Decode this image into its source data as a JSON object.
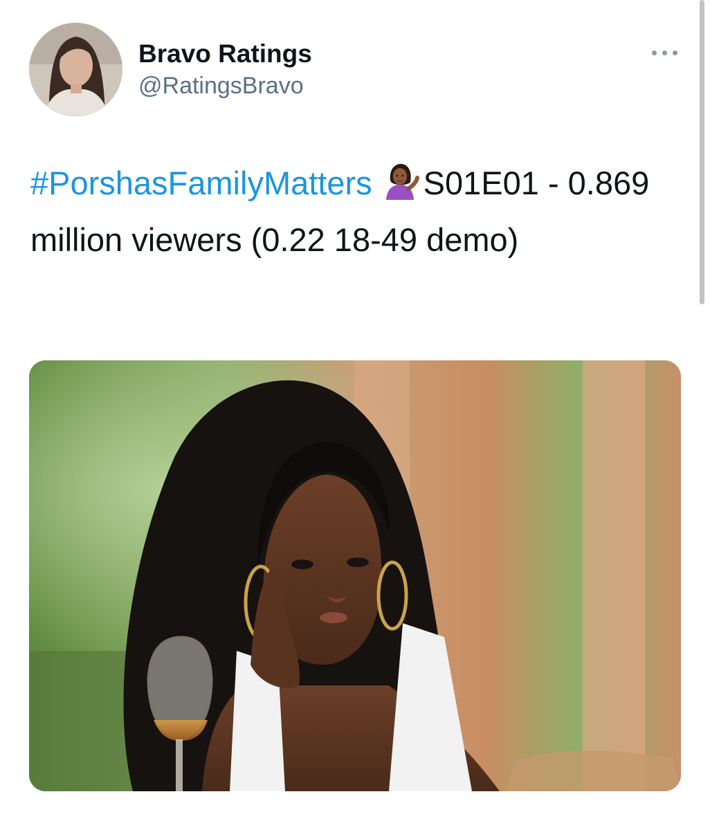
{
  "author": {
    "display_name": "Bravo Ratings",
    "handle": "@RatingsBravo"
  },
  "tweet": {
    "hashtag": "#PorshasFamilyMatters",
    "emoji": "woman-tipping-hand-emoji",
    "text_after_emoji": "S01E01 - 0.869 million viewers (0.22 18-49 demo)"
  },
  "icons": {
    "more": "more-options-icon"
  },
  "colors": {
    "hashtag": "#1b95e0",
    "text": "#0f1419",
    "secondary": "#5b7083"
  }
}
